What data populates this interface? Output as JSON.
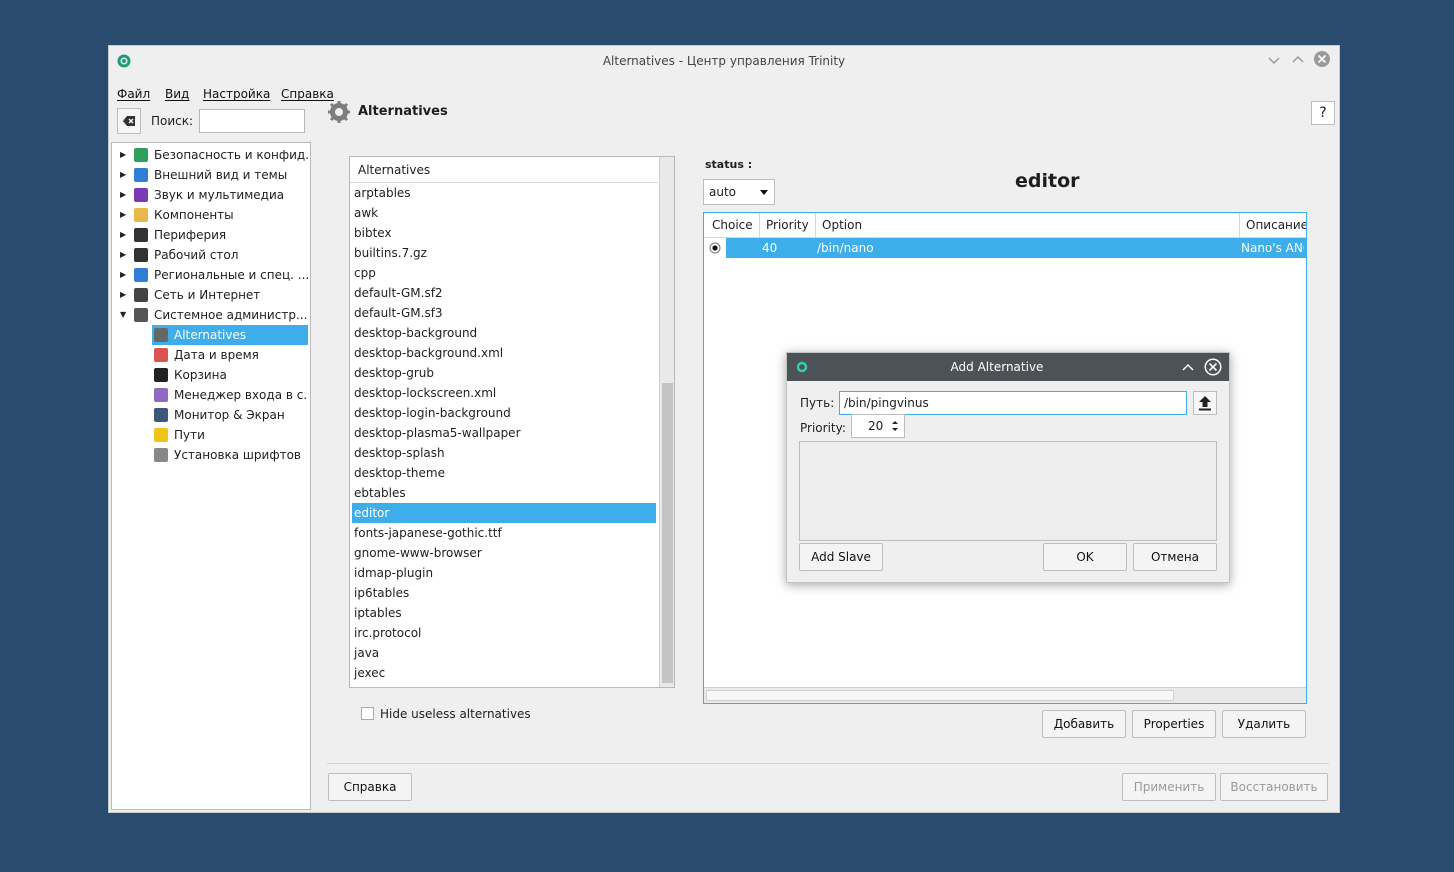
{
  "window": {
    "title": "Alternatives - Центр управления Trinity",
    "menu": [
      "Файл",
      "Вид",
      "Настройка",
      "Справка"
    ]
  },
  "search": {
    "label": "Поиск:",
    "value": ""
  },
  "tree": {
    "items": [
      {
        "label": "Безопасность и конфид...",
        "icon": "key-icon",
        "color": "#2e9e5e"
      },
      {
        "label": "Внешний вид и темы",
        "icon": "appearance-icon",
        "color": "#2f7fd6"
      },
      {
        "label": "Звук и мультимедиа",
        "icon": "multimedia-icon",
        "color": "#7a3ab8"
      },
      {
        "label": "Компоненты",
        "icon": "components-icon",
        "color": "#e8b84a"
      },
      {
        "label": "Периферия",
        "icon": "mouse-icon",
        "color": "#333333"
      },
      {
        "label": "Рабочий стол",
        "icon": "desktop-icon",
        "color": "#333333"
      },
      {
        "label": "Региональные и спец. ...",
        "icon": "regional-icon",
        "color": "#2f7fd6"
      },
      {
        "label": "Сеть и Интернет",
        "icon": "network-icon",
        "color": "#444444"
      },
      {
        "label": "Системное администр...",
        "icon": "system-icon",
        "color": "#555555"
      }
    ],
    "children": [
      {
        "label": "Alternatives",
        "icon": "alternatives-icon",
        "color": "#666666"
      },
      {
        "label": "Дата и время",
        "icon": "calendar-icon",
        "color": "#d9534f"
      },
      {
        "label": "Корзина",
        "icon": "trash-icon",
        "color": "#222222"
      },
      {
        "label": "Менеджер входа в с...",
        "icon": "user-icon",
        "color": "#8e6bbf"
      },
      {
        "label": "Монитор & Экран",
        "icon": "monitor-icon",
        "color": "#3c5a78"
      },
      {
        "label": "Пути",
        "icon": "folder-icon",
        "color": "#f0c419"
      },
      {
        "label": "Установка шрифтов",
        "icon": "font-icon",
        "color": "#888888"
      }
    ]
  },
  "module": {
    "title": "Alternatives",
    "help": "?"
  },
  "alternatives_list": {
    "header": "Alternatives",
    "items": [
      "arptables",
      "awk",
      "bibtex",
      "builtins.7.gz",
      "cpp",
      "default-GM.sf2",
      "default-GM.sf3",
      "desktop-background",
      "desktop-background.xml",
      "desktop-grub",
      "desktop-lockscreen.xml",
      "desktop-login-background",
      "desktop-plasma5-wallpaper",
      "desktop-splash",
      "desktop-theme",
      "ebtables",
      "editor",
      "fonts-japanese-gothic.ttf",
      "gnome-www-browser",
      "idmap-plugin",
      "ip6tables",
      "iptables",
      "irc.protocol",
      "java",
      "jexec"
    ],
    "selected": "editor"
  },
  "hide_useless": {
    "label": "Hide useless alternatives",
    "checked": false
  },
  "status": {
    "label": "status :",
    "value": "auto"
  },
  "current_name": "editor",
  "choices_table": {
    "columns": [
      "Choice",
      "Priority",
      "Option",
      "Описание"
    ],
    "rows": [
      {
        "priority": "40",
        "option": "/bin/nano",
        "description": "Nano's ANC"
      }
    ]
  },
  "right_buttons": {
    "add": "Добавить",
    "properties": "Properties",
    "delete": "Удалить"
  },
  "bottom_buttons": {
    "help": "Справка",
    "apply": "Применить",
    "restore": "Восстановить"
  },
  "dialog": {
    "title": "Add Alternative",
    "path_label": "Путь:",
    "path_value": "/bin/pingvinus",
    "priority_label": "Priority:",
    "priority_value": "20",
    "add_slave": "Add Slave",
    "ok": "OK",
    "cancel": "Отмена"
  }
}
